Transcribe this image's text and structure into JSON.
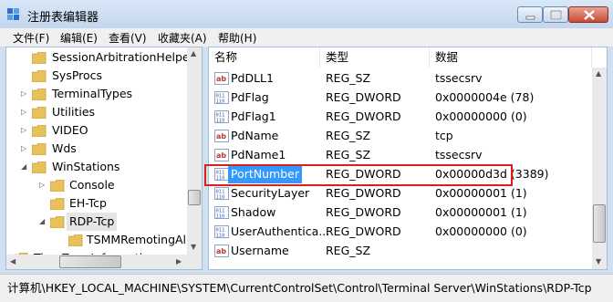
{
  "window": {
    "title": "注册表编辑器"
  },
  "menu": [
    "文件(F)",
    "编辑(E)",
    "查看(V)",
    "收藏夹(A)",
    "帮助(H)"
  ],
  "tree": [
    {
      "label": "SessionArbitrationHelper",
      "expander": ""
    },
    {
      "label": "SysProcs",
      "expander": ""
    },
    {
      "label": "TerminalTypes",
      "expander": "▷"
    },
    {
      "label": "Utilities",
      "expander": "▷"
    },
    {
      "label": "VIDEO",
      "expander": "▷"
    },
    {
      "label": "Wds",
      "expander": "▷"
    },
    {
      "label": "WinStations",
      "expander": "◢"
    },
    {
      "label": "Console",
      "expander": "▷"
    },
    {
      "label": "EH-Tcp",
      "expander": ""
    },
    {
      "label": "RDP-Tcp",
      "expander": "◢"
    },
    {
      "label": "TSMMRemotingAllo",
      "expander": ""
    },
    {
      "label": "TimeZoneInformation",
      "expander": ""
    }
  ],
  "list": {
    "columns": [
      "名称",
      "类型",
      "数据"
    ],
    "rows": [
      {
        "icon": "string-value-icon",
        "name": "PdDLL1",
        "type": "REG_SZ",
        "data": "tssecsrv"
      },
      {
        "icon": "binary-value-icon",
        "name": "PdFlag",
        "type": "REG_DWORD",
        "data": "0x0000004e (78)"
      },
      {
        "icon": "binary-value-icon",
        "name": "PdFlag1",
        "type": "REG_DWORD",
        "data": "0x00000000 (0)"
      },
      {
        "icon": "string-value-icon",
        "name": "PdName",
        "type": "REG_SZ",
        "data": "tcp"
      },
      {
        "icon": "string-value-icon",
        "name": "PdName1",
        "type": "REG_SZ",
        "data": "tssecsrv"
      },
      {
        "icon": "binary-value-icon",
        "name": "PortNumber",
        "type": "REG_DWORD",
        "data": "0x00000d3d (3389)"
      },
      {
        "icon": "binary-value-icon",
        "name": "SecurityLayer",
        "type": "REG_DWORD",
        "data": "0x00000001 (1)"
      },
      {
        "icon": "binary-value-icon",
        "name": "Shadow",
        "type": "REG_DWORD",
        "data": "0x00000001 (1)"
      },
      {
        "icon": "binary-value-icon",
        "name": "UserAuthentica...",
        "type": "REG_DWORD",
        "data": "0x00000000 (0)"
      },
      {
        "icon": "string-value-icon",
        "name": "Username",
        "type": "REG_SZ",
        "data": ""
      }
    ]
  },
  "status": "计算机\\HKEY_LOCAL_MACHINE\\SYSTEM\\CurrentControlSet\\Control\\Terminal Server\\WinStations\\RDP-Tcp",
  "colors": {
    "selection": "#3399ff",
    "highlight_border": "#e01d1d"
  }
}
